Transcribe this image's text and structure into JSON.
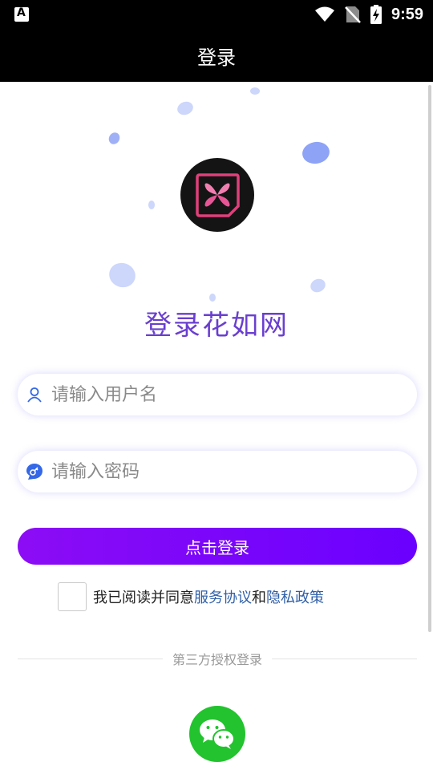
{
  "status_bar": {
    "time": "9:59",
    "icons": [
      "app-notification-icon",
      "wifi-icon",
      "no-sim-icon",
      "battery-charging-icon"
    ]
  },
  "header": {
    "title": "登录"
  },
  "app": {
    "name": "登录花如网"
  },
  "form": {
    "username_placeholder": "请输入用户名",
    "username_value": "",
    "password_placeholder": "请输入密码",
    "password_value": "",
    "login_button": "点击登录"
  },
  "agreement": {
    "checked": false,
    "prefix": "我已阅读并同意",
    "service_link": "服务协议",
    "conjunction": "和",
    "privacy_link": "隐私政策"
  },
  "third_party": {
    "label": "第三方授权登录",
    "providers": [
      "wechat-icon"
    ]
  },
  "colors": {
    "accent": "#7a00ff",
    "app_name": "#6a3fcf",
    "link": "#2f5fa8",
    "wechat": "#22c32e",
    "bubble": "#cdd6fb"
  }
}
